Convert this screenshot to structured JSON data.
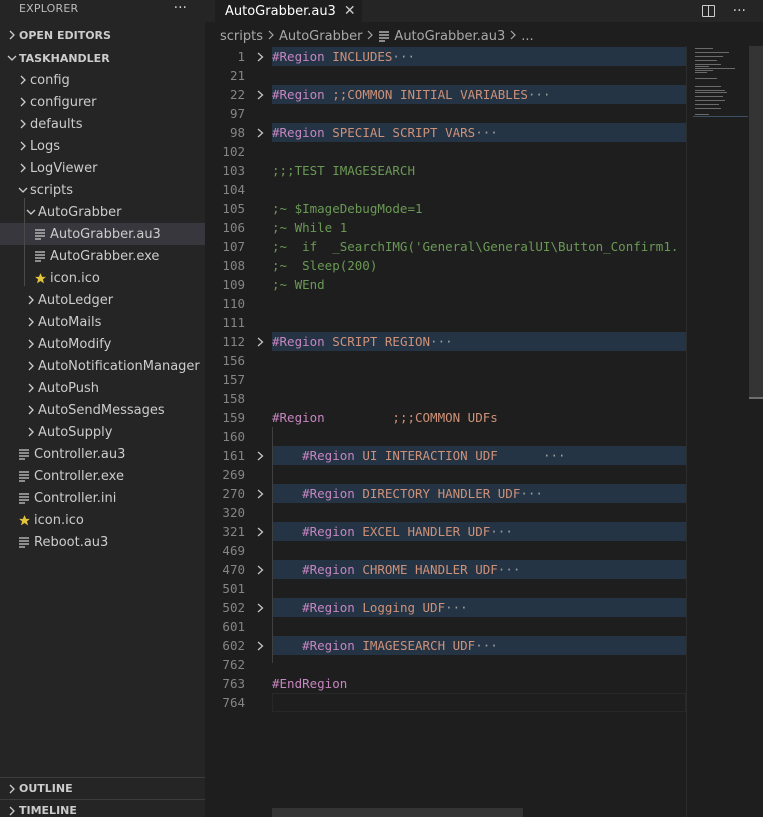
{
  "explorer": {
    "title": "EXPLORER",
    "more": "···",
    "open_editors": "OPEN EDITORS",
    "project": "TASKHANDLER",
    "tree": [
      {
        "label": "config",
        "type": "folder",
        "depth": 0,
        "open": false
      },
      {
        "label": "configurer",
        "type": "folder",
        "depth": 0,
        "open": false
      },
      {
        "label": "defaults",
        "type": "folder",
        "depth": 0,
        "open": false
      },
      {
        "label": "Logs",
        "type": "folder",
        "depth": 0,
        "open": false
      },
      {
        "label": "LogViewer",
        "type": "folder",
        "depth": 0,
        "open": false
      },
      {
        "label": "scripts",
        "type": "folder",
        "depth": 0,
        "open": true
      },
      {
        "label": "AutoGrabber",
        "type": "folder",
        "depth": 1,
        "open": true
      },
      {
        "label": "AutoGrabber.au3",
        "type": "file",
        "depth": 2,
        "icon": "lines-file-icon",
        "selected": true
      },
      {
        "label": "AutoGrabber.exe",
        "type": "file",
        "depth": 2,
        "icon": "lines-file-icon"
      },
      {
        "label": "icon.ico",
        "type": "file",
        "depth": 2,
        "icon": "star-icon"
      },
      {
        "label": "AutoLedger",
        "type": "folder",
        "depth": 1,
        "open": false
      },
      {
        "label": "AutoMails",
        "type": "folder",
        "depth": 1,
        "open": false
      },
      {
        "label": "AutoModify",
        "type": "folder",
        "depth": 1,
        "open": false
      },
      {
        "label": "AutoNotificationManager",
        "type": "folder",
        "depth": 1,
        "open": false
      },
      {
        "label": "AutoPush",
        "type": "folder",
        "depth": 1,
        "open": false
      },
      {
        "label": "AutoSendMessages",
        "type": "folder",
        "depth": 1,
        "open": false
      },
      {
        "label": "AutoSupply",
        "type": "folder",
        "depth": 1,
        "open": false
      },
      {
        "label": "Controller.au3",
        "type": "file",
        "depth": 0,
        "icon": "lines-file-icon"
      },
      {
        "label": "Controller.exe",
        "type": "file",
        "depth": 0,
        "icon": "lines-file-icon"
      },
      {
        "label": "Controller.ini",
        "type": "file",
        "depth": 0,
        "icon": "lines-file-icon"
      },
      {
        "label": "icon.ico",
        "type": "file",
        "depth": 0,
        "icon": "star-icon"
      },
      {
        "label": "Reboot.au3",
        "type": "file",
        "depth": 0,
        "icon": "lines-file-icon"
      }
    ],
    "outline": "OUTLINE",
    "timeline": "TIMELINE"
  },
  "tab": {
    "label": "AutoGrabber.au3",
    "close": "✕"
  },
  "breadcrumb": {
    "part1": "scripts",
    "part2": "AutoGrabber",
    "part3": "AutoGrabber.au3",
    "part4": "..."
  },
  "colors": {
    "accent_star": "#e2c339",
    "region_highlight": "#243444",
    "keyword": "#c586c0",
    "string": "#ce9178",
    "comment": "#6a9955"
  },
  "lines": [
    {
      "n": "1",
      "fold": true,
      "hl": true,
      "segs": [
        {
          "t": "#Region",
          "c": "kw"
        },
        {
          "t": " INCLUDES",
          "c": "str"
        },
        {
          "t": "···",
          "c": "ellipsis"
        }
      ]
    },
    {
      "n": "21",
      "segs": []
    },
    {
      "n": "22",
      "fold": true,
      "hl": true,
      "segs": [
        {
          "t": "#Region",
          "c": "kw"
        },
        {
          "t": " ;;COMMON INITIAL VARIABLES",
          "c": "str"
        },
        {
          "t": "···",
          "c": "ellipsis"
        }
      ]
    },
    {
      "n": "97",
      "segs": []
    },
    {
      "n": "98",
      "fold": true,
      "hl": true,
      "segs": [
        {
          "t": "#Region",
          "c": "kw"
        },
        {
          "t": " SPECIAL SCRIPT VARS",
          "c": "str"
        },
        {
          "t": "···",
          "c": "ellipsis"
        }
      ]
    },
    {
      "n": "102",
      "segs": []
    },
    {
      "n": "103",
      "segs": [
        {
          "t": ";;;TEST IMAGESEARCH",
          "c": "cm"
        }
      ]
    },
    {
      "n": "104",
      "segs": []
    },
    {
      "n": "105",
      "segs": [
        {
          "t": ";~ $ImageDebugMode=1",
          "c": "cm"
        }
      ]
    },
    {
      "n": "106",
      "segs": [
        {
          "t": ";~ While 1",
          "c": "cm"
        }
      ]
    },
    {
      "n": "107",
      "segs": [
        {
          "t": ";~  if  _SearchIMG('General\\GeneralUI\\Button_Confirm1.",
          "c": "cm"
        }
      ]
    },
    {
      "n": "108",
      "segs": [
        {
          "t": ";~  Sleep(200)",
          "c": "cm"
        }
      ]
    },
    {
      "n": "109",
      "segs": [
        {
          "t": ";~ WEnd",
          "c": "cm"
        }
      ]
    },
    {
      "n": "110",
      "segs": []
    },
    {
      "n": "111",
      "segs": []
    },
    {
      "n": "112",
      "fold": true,
      "hl": true,
      "segs": [
        {
          "t": "#Region",
          "c": "kw"
        },
        {
          "t": " SCRIPT REGION",
          "c": "str"
        },
        {
          "t": "···",
          "c": "ellipsis"
        }
      ]
    },
    {
      "n": "156",
      "segs": []
    },
    {
      "n": "157",
      "segs": []
    },
    {
      "n": "158",
      "segs": []
    },
    {
      "n": "159",
      "segs": [
        {
          "t": "#Region",
          "c": "kw"
        },
        {
          "t": "         ;;;COMMON UDFs",
          "c": "str"
        }
      ]
    },
    {
      "n": "160",
      "segs": []
    },
    {
      "n": "161",
      "fold": true,
      "hl": true,
      "segs": [
        {
          "t": "    #Region",
          "c": "kw"
        },
        {
          "t": " UI INTERACTION UDF      ",
          "c": "str"
        },
        {
          "t": "···",
          "c": "ellipsis"
        }
      ]
    },
    {
      "n": "269",
      "segs": []
    },
    {
      "n": "270",
      "fold": true,
      "hl": true,
      "segs": [
        {
          "t": "    #Region",
          "c": "kw"
        },
        {
          "t": " DIRECTORY HANDLER UDF",
          "c": "str"
        },
        {
          "t": "···",
          "c": "ellipsis"
        }
      ]
    },
    {
      "n": "320",
      "segs": []
    },
    {
      "n": "321",
      "fold": true,
      "hl": true,
      "segs": [
        {
          "t": "    #Region",
          "c": "kw"
        },
        {
          "t": " EXCEL HANDLER UDF",
          "c": "str"
        },
        {
          "t": "···",
          "c": "ellipsis"
        }
      ]
    },
    {
      "n": "469",
      "segs": []
    },
    {
      "n": "470",
      "fold": true,
      "hl": true,
      "segs": [
        {
          "t": "    #Region",
          "c": "kw"
        },
        {
          "t": " CHROME HANDLER UDF",
          "c": "str"
        },
        {
          "t": "···",
          "c": "ellipsis"
        }
      ]
    },
    {
      "n": "501",
      "segs": []
    },
    {
      "n": "502",
      "fold": true,
      "hl": true,
      "segs": [
        {
          "t": "    #Region",
          "c": "kw"
        },
        {
          "t": " Logging UDF",
          "c": "str"
        },
        {
          "t": "···",
          "c": "ellipsis"
        }
      ]
    },
    {
      "n": "601",
      "segs": []
    },
    {
      "n": "602",
      "fold": true,
      "hl": true,
      "segs": [
        {
          "t": "    #Region",
          "c": "kw"
        },
        {
          "t": " IMAGESEARCH UDF",
          "c": "str"
        },
        {
          "t": "···",
          "c": "ellipsis"
        }
      ]
    },
    {
      "n": "762",
      "segs": []
    },
    {
      "n": "763",
      "segs": [
        {
          "t": "#EndRegion",
          "c": "kw"
        }
      ]
    },
    {
      "n": "764",
      "cur": true,
      "segs": []
    }
  ]
}
